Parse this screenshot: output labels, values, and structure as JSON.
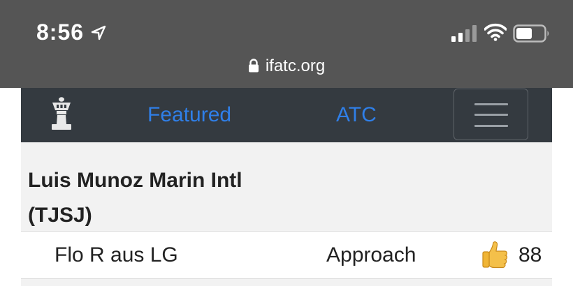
{
  "status_bar": {
    "time": "8:56",
    "icons": [
      "location-arrow-icon",
      "cellular-signal-icon",
      "wifi-icon",
      "battery-icon"
    ],
    "url": "ifatc.org"
  },
  "navbar": {
    "logo": "control-tower-icon",
    "links": [
      {
        "label": "Featured"
      },
      {
        "label": "ATC"
      }
    ],
    "menu_icon": "hamburger-menu-icon",
    "link_color": "#2f7fe8",
    "background": "#343a40"
  },
  "airport": {
    "name_line1": "Luis Munoz Marin Intl",
    "name_line2": "(TJSJ)"
  },
  "controllers": [
    {
      "name": "Flo R aus LG",
      "role": "Approach",
      "icon": "thumbs-up-icon",
      "score": "88"
    }
  ]
}
